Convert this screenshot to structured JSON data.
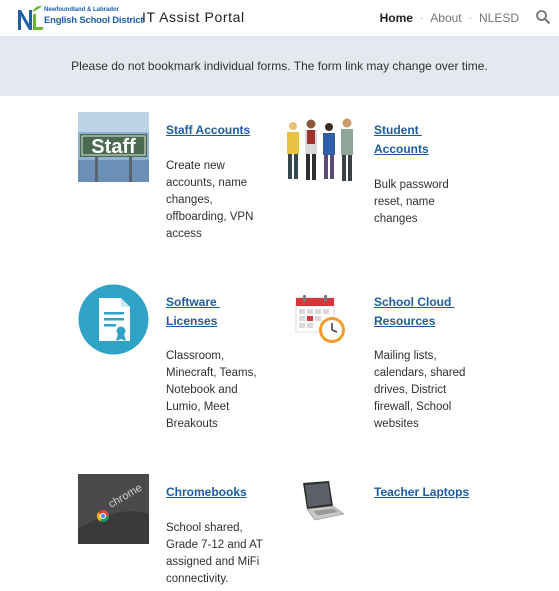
{
  "header": {
    "logo_line1": "Newfoundland & Labrador",
    "logo_line2": "English School District",
    "site_title": "IT Assist Portal",
    "nav": [
      "Home",
      "About",
      "NLESD"
    ],
    "nav_separator": "·"
  },
  "banner": {
    "text": "Please do not bookmark individual forms. The form link may change over time."
  },
  "cards": [
    {
      "title_lines": [
        "Staff Accounts"
      ],
      "description_lines": [
        "Create new",
        "accounts, name",
        "changes,",
        "offboarding, VPN",
        "access"
      ],
      "image": "staff-sign-image",
      "image_text": "Staff"
    },
    {
      "title_lines": [
        "Student ",
        "Accounts"
      ],
      "description_lines": [
        "Bulk password",
        "reset, name",
        "changes"
      ],
      "image": "students-illustration"
    },
    {
      "title_lines": [
        "Software ",
        "Licenses"
      ],
      "description_lines": [
        "Classroom,",
        "Minecraft, Teams,",
        "Notebook and",
        "Lumio, Meet",
        "Breakouts"
      ],
      "image": "certificate-document-icon"
    },
    {
      "title_lines": [
        "School Cloud ",
        "Resources"
      ],
      "description_lines": [
        "Mailing lists,",
        "calendars, shared",
        "drives, District",
        "firewall, School",
        "websites"
      ],
      "image": "calendar-clock-icon"
    },
    {
      "title_lines": [
        "Chromebooks"
      ],
      "description_lines": [
        "School shared,",
        "Grade 7-12 and AT",
        "assigned and MiFi",
        "connectivity."
      ],
      "image": "chrome-laptop-image",
      "image_text": "chrome"
    },
    {
      "title_lines": [
        "Teacher Laptops"
      ],
      "description_lines": [],
      "image": "laptop-icon"
    }
  ],
  "colors": {
    "link": "#1d5ca0",
    "banner_bg": "#e3e9ee",
    "logo_blue": "#1f5ea8",
    "logo_green": "#6bb33b"
  }
}
